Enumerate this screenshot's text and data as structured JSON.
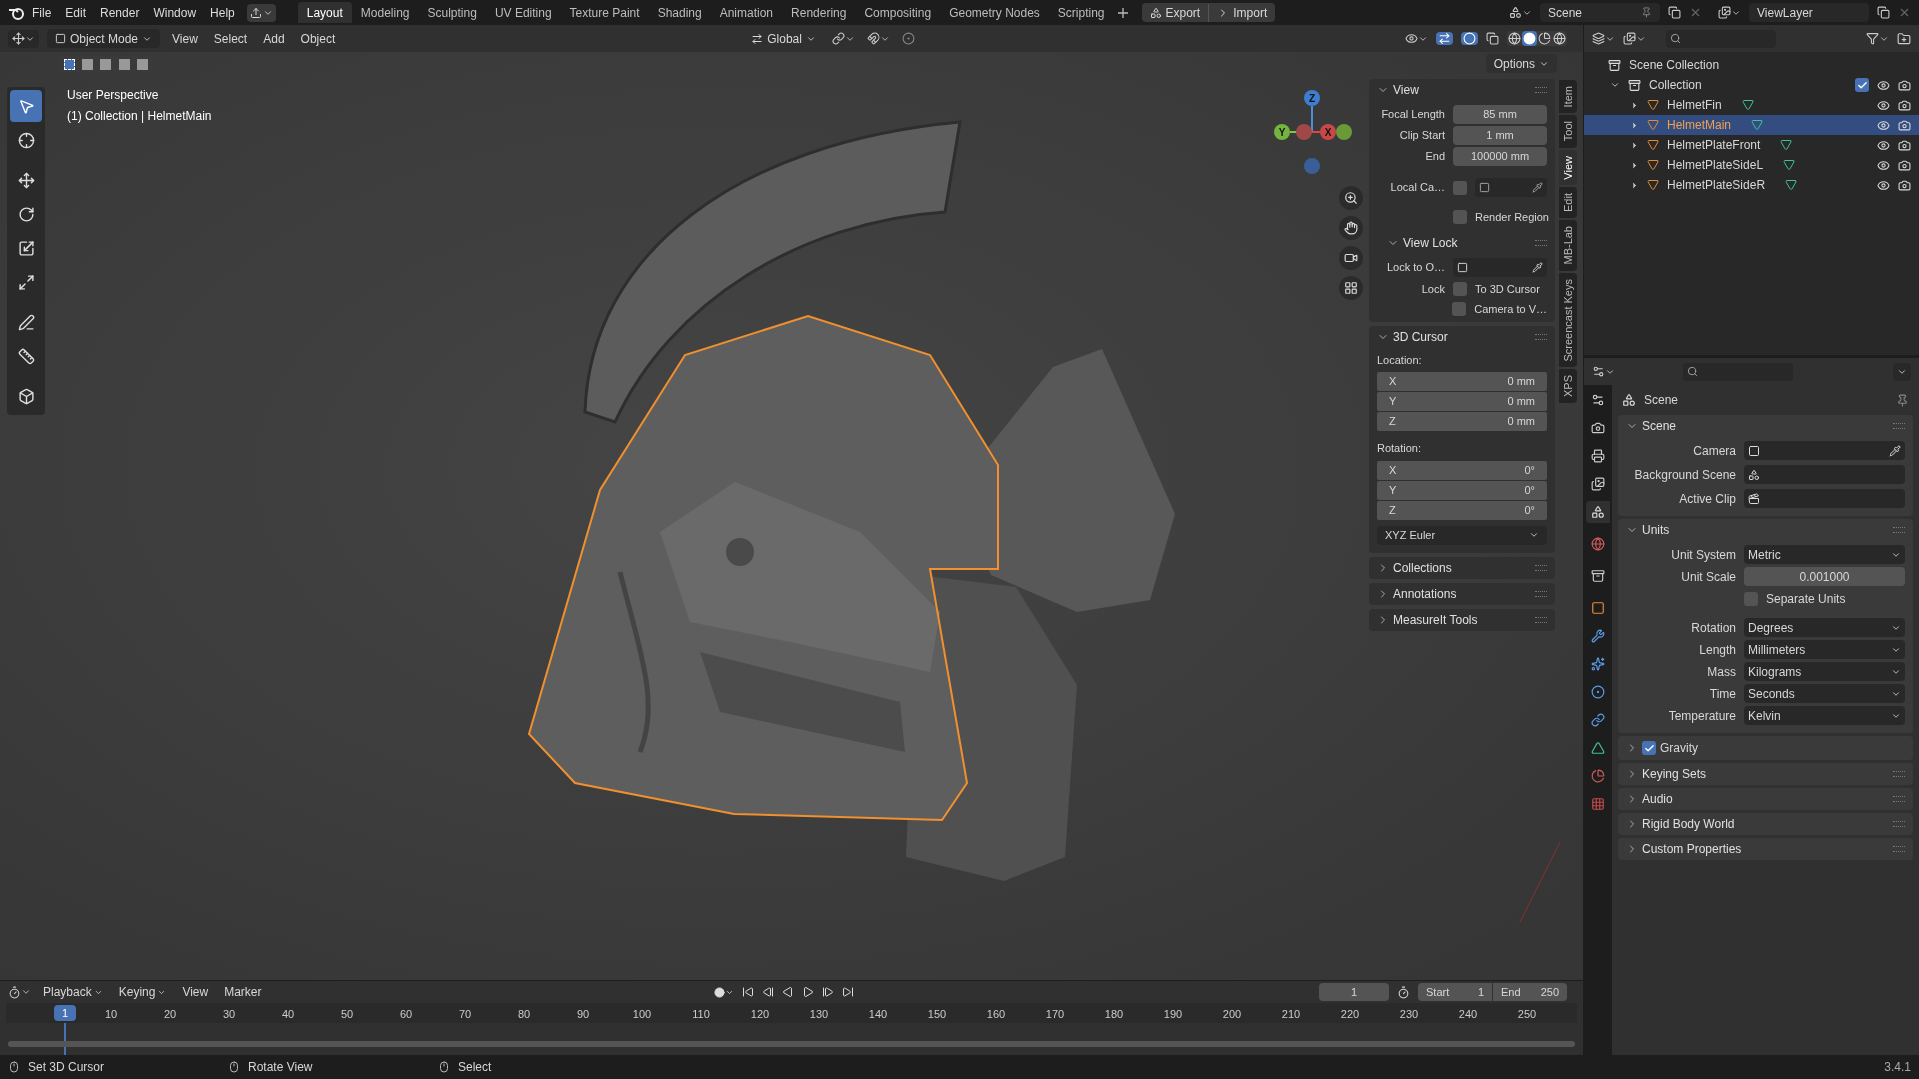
{
  "top_bar": {
    "menus": [
      "File",
      "Edit",
      "Render",
      "Window",
      "Help"
    ],
    "workspaces": [
      {
        "label": "Layout",
        "selected": true
      },
      {
        "label": "Modeling",
        "selected": false
      },
      {
        "label": "Sculpting",
        "selected": false
      },
      {
        "label": "UV Editing",
        "selected": false
      },
      {
        "label": "Texture Paint",
        "selected": false
      },
      {
        "label": "Shading",
        "selected": false
      },
      {
        "label": "Animation",
        "selected": false
      },
      {
        "label": "Rendering",
        "selected": false
      },
      {
        "label": "Compositing",
        "selected": false
      },
      {
        "label": "Geometry Nodes",
        "selected": false
      },
      {
        "label": "Scripting",
        "selected": false
      }
    ],
    "actions": [
      "Export",
      "Import"
    ],
    "scene": "Scene",
    "view_layer": "ViewLayer"
  },
  "viewport_header": {
    "mode": "Object Mode",
    "menus": [
      "View",
      "Select",
      "Add",
      "Object"
    ],
    "orientation": "Global",
    "options": "Options"
  },
  "viewport": {
    "perspective": "User Perspective",
    "context": "(1) Collection | HelmetMain",
    "tools": [
      {
        "kind": "select",
        "selected": true
      },
      {
        "kind": "cursor",
        "selected": false
      },
      {
        "kind": "move",
        "selected": false
      },
      {
        "kind": "rotate",
        "selected": false
      },
      {
        "kind": "scale",
        "selected": false
      },
      {
        "kind": "transform",
        "selected": false
      },
      {
        "kind": "annotate",
        "selected": false
      },
      {
        "kind": "measure",
        "selected": false
      },
      {
        "kind": "add_cube",
        "selected": false
      }
    ],
    "gizmo": {
      "z": "Z",
      "y": "Y",
      "x": "X"
    }
  },
  "sidebar": {
    "tabs": [
      {
        "label": "Item",
        "selected": false
      },
      {
        "label": "Tool",
        "selected": false
      },
      {
        "label": "View",
        "selected": true
      },
      {
        "label": "Edit",
        "selected": false
      },
      {
        "label": "MB-Lab",
        "selected": false
      },
      {
        "label": "Screencast Keys",
        "selected": false
      },
      {
        "label": "XPS",
        "selected": false
      }
    ],
    "view_panel": {
      "title": "View",
      "fields": [
        {
          "label": "Focal Length",
          "value": "85 mm"
        },
        {
          "label": "Clip Start",
          "value": "1 mm"
        },
        {
          "label": "End",
          "value": "100000 mm"
        }
      ],
      "local_camera": {
        "label": "Local Ca…",
        "checked": false
      },
      "render_region": {
        "label": "Render Region",
        "checked": false
      }
    },
    "view_lock": {
      "title": "View Lock",
      "lock_to": "Lock to O…",
      "lock_label": "Lock",
      "options": [
        {
          "label": "To 3D Cursor",
          "checked": false
        },
        {
          "label": "Camera to V…",
          "checked": false
        }
      ]
    },
    "cursor_panel": {
      "title": "3D Cursor",
      "location_label": "Location:",
      "location": [
        {
          "axis": "X",
          "value": "0 mm"
        },
        {
          "axis": "Y",
          "value": "0 mm"
        },
        {
          "axis": "Z",
          "value": "0 mm"
        }
      ],
      "rotation_label": "Rotation:",
      "rotation": [
        {
          "axis": "X",
          "value": "0°"
        },
        {
          "axis": "Y",
          "value": "0°"
        },
        {
          "axis": "Z",
          "value": "0°"
        }
      ],
      "rotation_mode": "XYZ Euler"
    },
    "collapsed_panels": [
      "Collections",
      "Annotations",
      "MeasureIt Tools"
    ]
  },
  "outliner": {
    "root": "Scene Collection",
    "collection": {
      "label": "Collection",
      "checked": true,
      "expanded": true,
      "children": [
        {
          "label": "HelmetFin",
          "selected": false
        },
        {
          "label": "HelmetMain",
          "selected": true
        },
        {
          "label": "HelmetPlateFront",
          "selected": false
        },
        {
          "label": "HelmetPlateSideL",
          "selected": false
        },
        {
          "label": "HelmetPlateSideR",
          "selected": false
        }
      ]
    }
  },
  "properties": {
    "context": "Scene",
    "tabs": [
      {
        "kind": "tool",
        "selected": false
      },
      {
        "kind": "render",
        "selected": false
      },
      {
        "kind": "output",
        "selected": false
      },
      {
        "kind": "view_layer",
        "selected": false
      },
      {
        "kind": "scene",
        "selected": true
      },
      {
        "kind": "world",
        "selected": false
      },
      {
        "kind": "collection",
        "selected": false
      },
      {
        "kind": "object",
        "selected": false
      },
      {
        "kind": "modifiers",
        "selected": false
      },
      {
        "kind": "particles",
        "selected": false
      },
      {
        "kind": "physics",
        "selected": false
      },
      {
        "kind": "constraints",
        "selected": false
      },
      {
        "kind": "data",
        "selected": false
      },
      {
        "kind": "material",
        "selected": false
      },
      {
        "kind": "texture",
        "selected": false
      }
    ],
    "scene_panel": {
      "title": "Scene",
      "rows": [
        {
          "label": "Camera",
          "kind": "camera"
        },
        {
          "label": "Background Scene",
          "kind": "scene"
        },
        {
          "label": "Active Clip",
          "kind": "clip"
        }
      ]
    },
    "units_panel": {
      "title": "Units",
      "rows": [
        {
          "kind": "dropdown",
          "label": "Unit System",
          "value": "Metric"
        },
        {
          "kind": "number",
          "label": "Unit Scale",
          "value": "0.001000"
        },
        {
          "kind": "checkbox",
          "label": "Separate Units",
          "checked": false
        },
        {
          "kind": "dropdown",
          "label": "Rotation",
          "value": "Degrees"
        },
        {
          "kind": "dropdown",
          "label": "Length",
          "value": "Millimeters"
        },
        {
          "kind": "dropdown",
          "label": "Mass",
          "value": "Kilograms"
        },
        {
          "kind": "dropdown",
          "label": "Time",
          "value": "Seconds"
        },
        {
          "kind": "dropdown",
          "label": "Temperature",
          "value": "Kelvin"
        }
      ]
    },
    "gravity": {
      "label": "Gravity",
      "checked": true
    },
    "collapsed_panels": [
      "Keying Sets",
      "Audio",
      "Rigid Body World",
      "Custom Properties"
    ]
  },
  "timeline": {
    "menus": [
      "Playback",
      "Keying",
      "View",
      "Marker"
    ],
    "current_frame": "1",
    "start_label": "Start",
    "start": "1",
    "end_label": "End",
    "end": "250",
    "ruler_current": "1",
    "ruler": [
      "10",
      "20",
      "30",
      "40",
      "50",
      "60",
      "70",
      "80",
      "90",
      "100",
      "110",
      "120",
      "130",
      "140",
      "150",
      "160",
      "170",
      "180",
      "190",
      "200",
      "210",
      "220",
      "230",
      "240",
      "250"
    ]
  },
  "status_bar": {
    "hints": [
      "Set 3D Cursor",
      "Rotate View",
      "Select"
    ],
    "version": "3.4.1"
  }
}
